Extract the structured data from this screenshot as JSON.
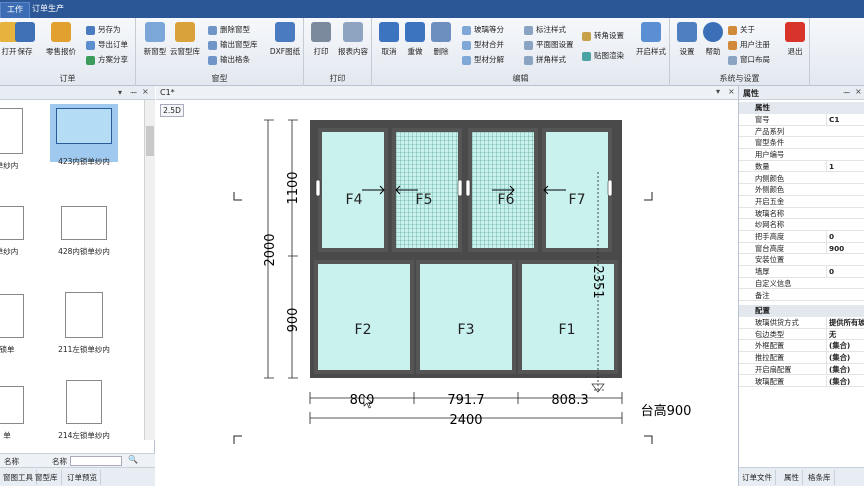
{
  "tabs": [
    "工作",
    "订单生产"
  ],
  "ribbon": {
    "groups": [
      {
        "label": "订单",
        "items": [
          "打开",
          "保存",
          "零售报价",
          "另存为",
          "导出订单",
          "方案分享"
        ]
      },
      {
        "label": "窗型",
        "items": [
          "新窗型",
          "云窗型库",
          "删除窗型",
          "输出窗型库",
          "输出格条",
          "DXF图纸"
        ]
      },
      {
        "label": "打印",
        "items": [
          "打印",
          "报表内容"
        ]
      },
      {
        "label": "编辑",
        "items": [
          "取消",
          "重做",
          "删除",
          "玻璃等分",
          "型材合并",
          "型材分解",
          "标注样式",
          "平面图设置",
          "拼角样式",
          "转角设置",
          "贴图渲染",
          "开启样式"
        ]
      },
      {
        "label": "系统与设置",
        "items": [
          "设置",
          "帮助",
          "关于",
          "用户注册",
          "窗口布局",
          "退出"
        ]
      }
    ]
  },
  "left_panel": {
    "thumbnails": [
      {
        "caption": "单纱内"
      },
      {
        "caption": "423内锁单纱内"
      },
      {
        "caption": "单纱内"
      },
      {
        "caption": "428内锁单纱内"
      },
      {
        "caption": "锁单"
      },
      {
        "caption": "211左锁单纱内"
      },
      {
        "caption": "单"
      },
      {
        "caption": "214左锁单纱内"
      }
    ],
    "search_label_1": "名称",
    "search_label_2": "名称",
    "bottom_tabs": [
      "窗图工具",
      "窗型库",
      "订单预览"
    ]
  },
  "canvas": {
    "tab_title": "C1*",
    "view_button": "2.5D",
    "panels": [
      "F4",
      "F5",
      "F6",
      "F7",
      "F2",
      "F3",
      "F1"
    ],
    "dims": {
      "top_height": "1100",
      "total_height": "2000",
      "bottom_height": "900",
      "right_height": "2351",
      "w1": "800",
      "w2": "791.7",
      "w3": "808.3",
      "total_width": "2400",
      "sill": "台高900"
    },
    "colors": {
      "frame": "#4a4a4a",
      "glass": "#c9f2ee",
      "mesh": "#5aa89a"
    }
  },
  "right_panel": {
    "title": "属性",
    "section_1": "属性",
    "rows": [
      {
        "k": "窗号",
        "v": "C1"
      },
      {
        "k": "产品系列",
        "v": ""
      },
      {
        "k": "窗型条件",
        "v": ""
      },
      {
        "k": "用户编号",
        "v": ""
      },
      {
        "k": "数量",
        "v": "1"
      },
      {
        "k": "内侧颜色",
        "v": ""
      },
      {
        "k": "外侧颜色",
        "v": ""
      },
      {
        "k": "开启五金",
        "v": ""
      },
      {
        "k": "玻璃名称",
        "v": ""
      },
      {
        "k": "纱网名称",
        "v": ""
      },
      {
        "k": "把手高度",
        "v": "0"
      },
      {
        "k": "窗台高度",
        "v": "900"
      },
      {
        "k": "安装位置",
        "v": ""
      },
      {
        "k": "墙厚",
        "v": "0"
      },
      {
        "k": "自定义信息",
        "v": ""
      },
      {
        "k": "备注",
        "v": ""
      }
    ],
    "section_2": "配置",
    "rows2": [
      {
        "k": "玻璃供货方式",
        "v": "提供所有玻"
      },
      {
        "k": "包边类型",
        "v": "无"
      },
      {
        "k": "外框配置",
        "v": "(集合)"
      },
      {
        "k": "推拉配置",
        "v": "(集合)"
      },
      {
        "k": "开启扇配置",
        "v": "(集合)"
      },
      {
        "k": "玻璃配置",
        "v": "(集合)"
      }
    ],
    "bottom_tabs": [
      "订单文件",
      "属性",
      "格条库"
    ]
  }
}
